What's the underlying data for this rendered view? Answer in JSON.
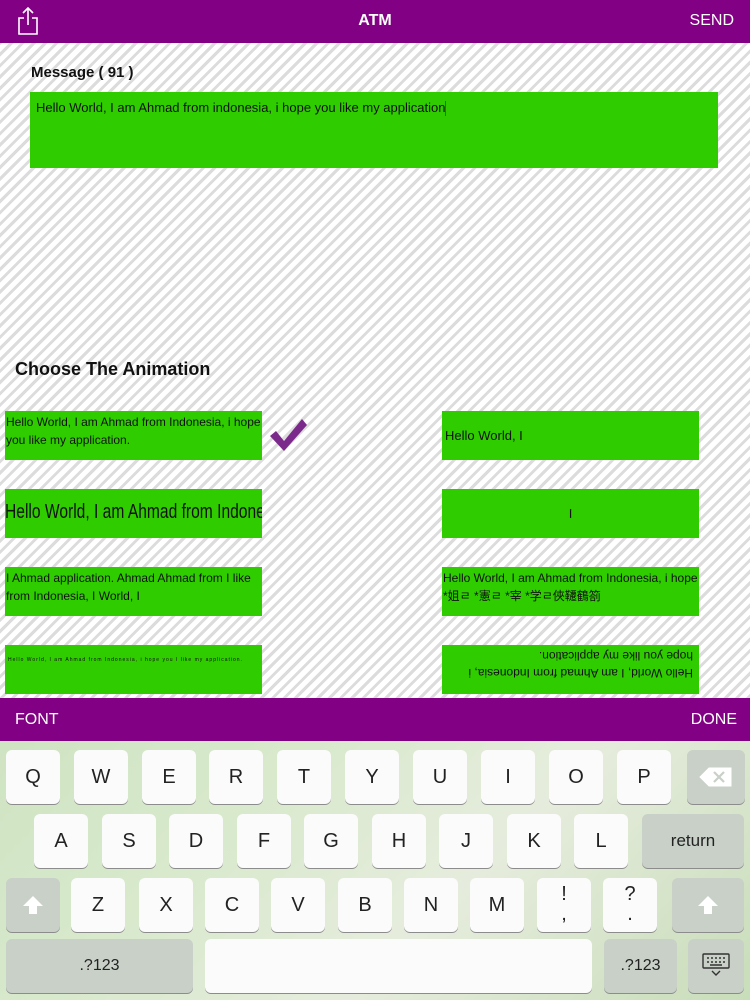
{
  "header": {
    "title": "ATM",
    "send_label": "SEND",
    "share_icon": "share-icon"
  },
  "message": {
    "label": "Message ( 91 )",
    "text": "Hello World, I am Ahmad from indonesia, i hope you like my application"
  },
  "animations": {
    "heading": "Choose The Animation",
    "selected_index": 0,
    "options": [
      {
        "text": "Hello World, I am Ahmad from Indonesia, i hope you like my application."
      },
      {
        "text": "Hello World, I"
      },
      {
        "text": "Hello World, I am Ahmad from Indonesia, i hope"
      },
      {
        "text": "I"
      },
      {
        "text": "I Ahmad application. Ahmad Ahmad from I like from Indonesia, I World, I"
      },
      {
        "text": "Hello World, I am Ahmad from Indonesia, i hope *姐ㄹ *憲ㄹ *宰 *学ㄹ俠韆鶴箚"
      },
      {
        "text": "Hello World, I am Ahmad from Indonesia, i hope you I like my application."
      },
      {
        "text": "Hello World, I am Ahmad from Indonesia, i hope you like my application."
      }
    ]
  },
  "toolbar": {
    "font_label": "FONT",
    "done_label": "DONE"
  },
  "keyboard": {
    "row1": [
      "Q",
      "W",
      "E",
      "R",
      "T",
      "Y",
      "U",
      "I",
      "O",
      "P"
    ],
    "row2": [
      "A",
      "S",
      "D",
      "F",
      "G",
      "H",
      "J",
      "K",
      "L"
    ],
    "row3": [
      "Z",
      "X",
      "C",
      "V",
      "B",
      "N",
      "M"
    ],
    "punct1": "!\n,",
    "punct2": "?\n.",
    "return_label": "return",
    "numbers_label": ".?123",
    "backspace_icon": "backspace-icon",
    "shift_icon": "shift-icon",
    "keyboard_icon": "keyboard-hide-icon"
  },
  "colors": {
    "accent": "#820083",
    "animation_bg": "#2fcd00",
    "check": "#7b2a8b"
  }
}
